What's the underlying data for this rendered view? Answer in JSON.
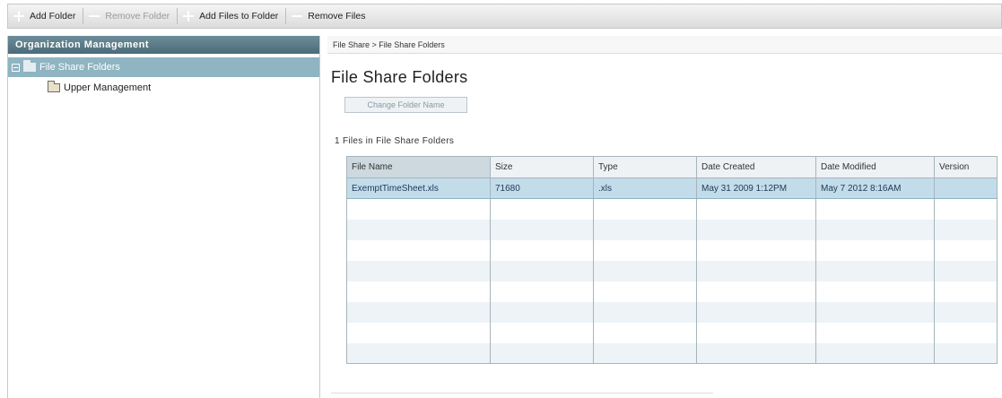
{
  "toolbar": {
    "add_folder": "Add Folder",
    "remove_folder": "Remove Folder",
    "add_files_to_folder": "Add Files to Folder",
    "remove_files": "Remove Files"
  },
  "sidebar": {
    "title": "Organization Management",
    "root": {
      "label": "File Share Folders"
    },
    "children": [
      {
        "label": "Upper Management"
      }
    ]
  },
  "breadcrumb": "File Share > File Share Folders",
  "main": {
    "title": "File Share Folders",
    "change_button": "Change Folder Name",
    "files_count": "1 Files in File Share Folders",
    "table": {
      "columns": [
        "File Name",
        "Size",
        "Type",
        "Date Created",
        "Date Modified",
        "Version"
      ],
      "rows": [
        [
          "ExemptTimeSheet.xls",
          "71680",
          ".xls",
          "May 31 2009  1:12PM",
          "May  7 2012  8:16AM",
          ""
        ]
      ]
    }
  },
  "colors": {
    "header_bg": "#5a7a87",
    "selection": "#c3dcea",
    "tree_selected": "#8fb4c2"
  }
}
